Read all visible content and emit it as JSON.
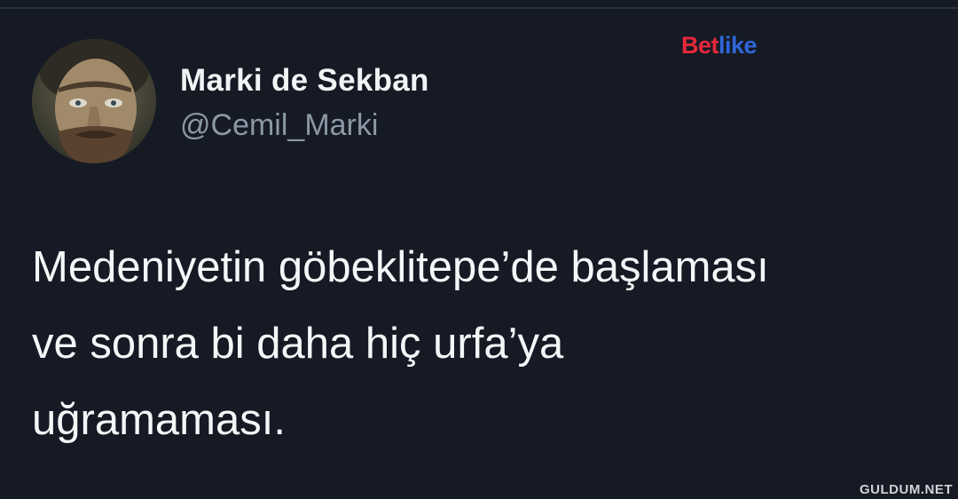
{
  "tweet": {
    "author": {
      "display_name": "Marki de Sekban",
      "handle": "@Cemil_Marki",
      "avatar": "avatar-photo"
    },
    "lines": [
      "Medeniyetin göbeklitepe’de başlaması",
      "ve sonra bi daha hiç urfa’ya",
      "uğramaması."
    ]
  },
  "brand": {
    "part1": "Bet",
    "part2": "like",
    "colors": {
      "part1": "#e8283c",
      "part2": "#2f66d8"
    }
  },
  "watermark": "GULDUM.NET",
  "colors": {
    "background": "#151a24",
    "text": "#f5f6f7",
    "muted": "#8b98a5"
  }
}
